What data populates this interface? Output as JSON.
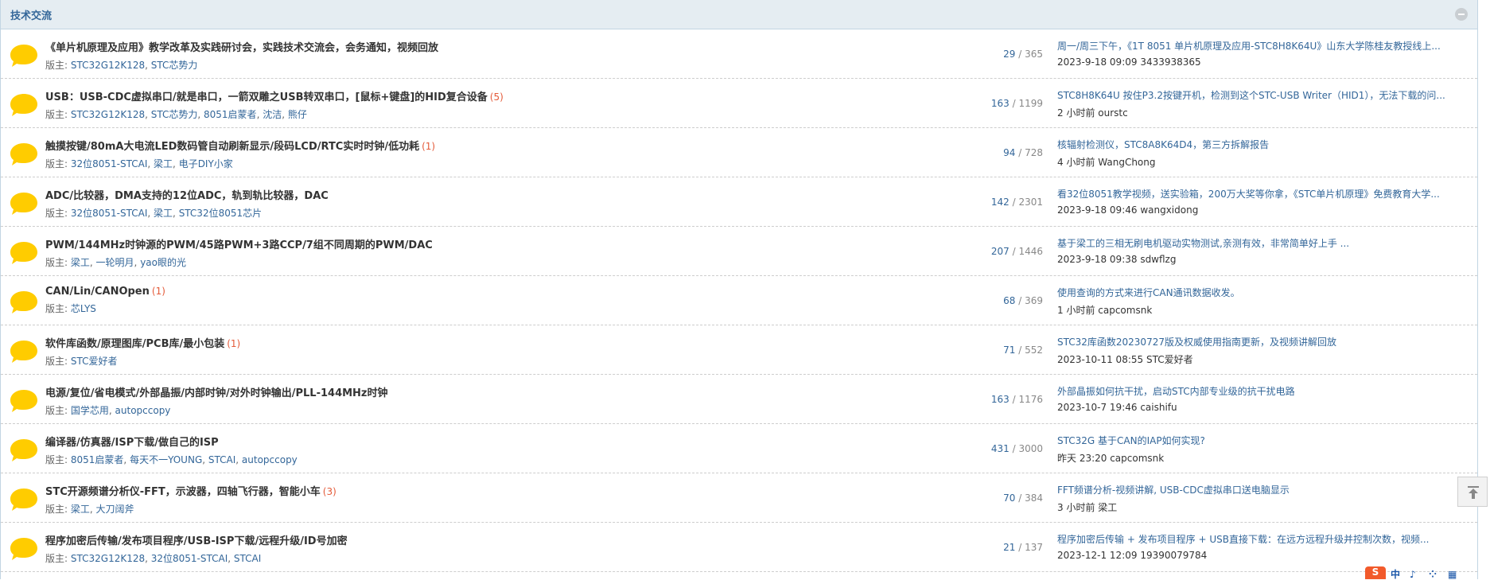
{
  "section": {
    "title": "技术交流"
  },
  "moderator_prefix": "版主:",
  "forums": [
    {
      "title": "《单片机原理及应用》教学改革及实践研讨会，实践技术交流会，会务通知，视频回放",
      "new_count": "",
      "moderators": [
        "STC32G12K128",
        "STC芯势力"
      ],
      "threads": "29",
      "posts": "365",
      "last_title": "周一/周三下午，《1T 8051 单片机原理及应用-STC8H8K64U》山东大学陈桂友教授线上...",
      "last_meta": "2023-9-18 09:09 3433938365"
    },
    {
      "title": "USB：USB-CDC虚拟串口/就是串口，一箭双雕之USB转双串口，[鼠标+键盘]的HID复合设备",
      "new_count": "(5)",
      "moderators": [
        "STC32G12K128",
        "STC芯势力",
        "8051启蒙者",
        "沈洁",
        "熊仔"
      ],
      "threads": "163",
      "posts": "1199",
      "last_title": "STC8H8K64U 按住P3.2按键开机，检测到这个STC-USB Writer（HID1），无法下载的问...",
      "last_meta": "2 小时前 ourstc"
    },
    {
      "title": "触摸按键/80mA大电流LED数码管自动刷新显示/段码LCD/RTC实时时钟/低功耗",
      "new_count": "(1)",
      "moderators": [
        "32位8051-STCAI",
        "梁工",
        "电子DIY小家"
      ],
      "threads": "94",
      "posts": "728",
      "last_title": "核辐射检测仪，STC8A8K64D4，第三方拆解报告",
      "last_meta": "4 小时前 WangChong"
    },
    {
      "title": "ADC/比较器，DMA支持的12位ADC，轨到轨比较器，DAC",
      "new_count": "",
      "moderators": [
        "32位8051-STCAI",
        "梁工",
        "STC32位8051芯片"
      ],
      "threads": "142",
      "posts": "2301",
      "last_title": "看32位8051教学视频，送实验箱，200万大奖等你拿，《STC单片机原理》免费教育大学...",
      "last_meta": "2023-9-18 09:46 wangxidong"
    },
    {
      "title": "PWM/144MHz时钟源的PWM/45路PWM+3路CCP/7组不同周期的PWM/DAC",
      "new_count": "",
      "moderators": [
        "梁工",
        "一轮明月",
        "yao眼的光"
      ],
      "threads": "207",
      "posts": "1446",
      "last_title": "基于梁工的三相无刷电机驱动实物测试,亲测有效，非常简单好上手 ...",
      "last_meta": "2023-9-18 09:38 sdwflzg"
    },
    {
      "title": "CAN/Lin/CANOpen",
      "new_count": "(1)",
      "moderators": [
        "芯LYS"
      ],
      "threads": "68",
      "posts": "369",
      "last_title": "使用查询的方式来进行CAN通讯数据收发。",
      "last_meta": "1 小时前 capcomsnk"
    },
    {
      "title": "软件库函数/原理图库/PCB库/最小包装",
      "new_count": "(1)",
      "moderators": [
        "STC爱好者"
      ],
      "threads": "71",
      "posts": "552",
      "last_title": "STC32库函数20230727版及权威使用指南更新，及视频讲解回放",
      "last_meta": "2023-10-11 08:55 STC爱好者"
    },
    {
      "title": "电源/复位/省电模式/外部晶振/内部时钟/对外时钟输出/PLL-144MHz时钟",
      "new_count": "",
      "moderators": [
        "国学芯用",
        "autopccopy"
      ],
      "threads": "163",
      "posts": "1176",
      "last_title": "外部晶振如何抗干扰，启动STC内部专业级的抗干扰电路",
      "last_meta": "2023-10-7 19:46 caishifu"
    },
    {
      "title": "编译器/仿真器/ISP下载/做自己的ISP",
      "new_count": "",
      "moderators": [
        "8051启蒙者",
        "每天不一YOUNG",
        "STCAI",
        "autopccopy"
      ],
      "threads": "431",
      "posts": "3000",
      "last_title": "STC32G 基于CAN的IAP如何实现?",
      "last_meta": "昨天 23:20 capcomsnk"
    },
    {
      "title": "STC开源频谱分析仪-FFT，示波器，四轴飞行器，智能小车",
      "new_count": "(3)",
      "moderators": [
        "梁工",
        "大刀阔斧"
      ],
      "threads": "70",
      "posts": "384",
      "last_title": "FFT频谱分析-视频讲解, USB-CDC虚拟串口送电脑显示",
      "last_meta": "3 小时前 梁工"
    },
    {
      "title": "程序加密后传输/发布项目程序/USB-ISP下载/远程升级/ID号加密",
      "new_count": "",
      "moderators": [
        "STC32G12K128",
        "32位8051-STCAI",
        "STCAI"
      ],
      "threads": "21",
      "posts": "137",
      "last_title": "程序加密后传输 + 发布项目程序 + USB直接下载：在远方远程升级并控制次数，视频...",
      "last_meta": "2023-12-1 12:09 19390079784"
    }
  ],
  "widget": {
    "s_label": "S",
    "icons": [
      "中",
      "♪",
      "⁘",
      "▦"
    ]
  },
  "colors": {
    "link": "#336699",
    "new": "#e45b3a",
    "icon": "#ffcc00",
    "header_bg": "#e5edf2"
  }
}
